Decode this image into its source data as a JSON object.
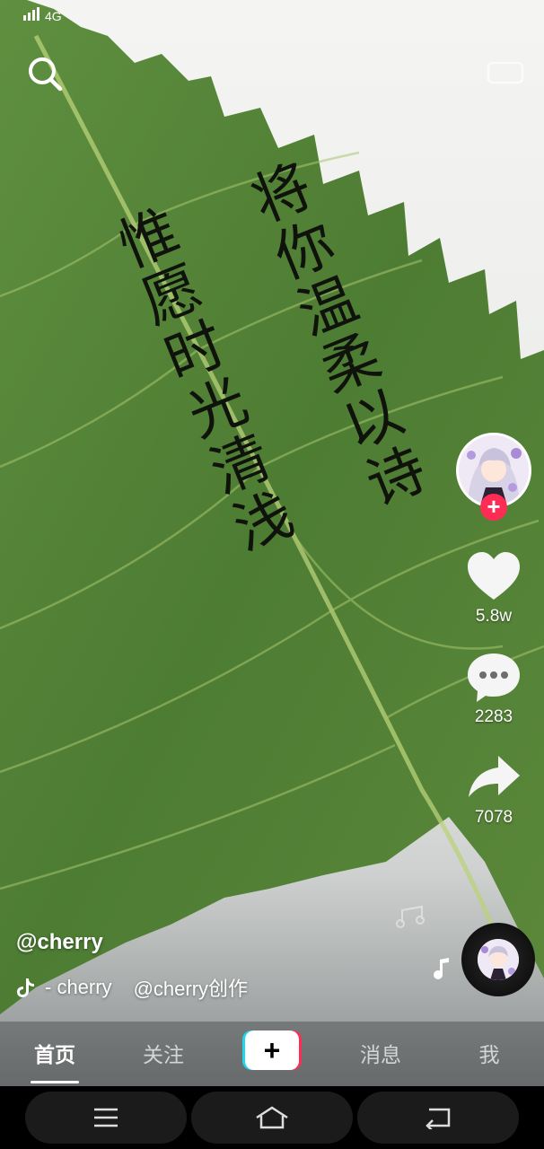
{
  "status_bar": {
    "network": "4G"
  },
  "poem": {
    "columns": [
      "将你温柔以诗",
      "惟愿时光清浅"
    ]
  },
  "creator": {
    "handle": "@cherry",
    "avatar_icon": "anime-girl-avatar-icon",
    "follow_symbol": "+"
  },
  "actions": {
    "likes": "5.8w",
    "comments": "2283",
    "shares": "7078"
  },
  "music": {
    "track": "- cherry",
    "credit": "@cherry创作"
  },
  "tabs": [
    {
      "label": "首页",
      "active": true
    },
    {
      "label": "关注",
      "active": false
    },
    {
      "label": "+",
      "active": false
    },
    {
      "label": "消息",
      "active": false
    },
    {
      "label": "我",
      "active": false
    }
  ],
  "colors": {
    "accent_red": "#fe2c55",
    "accent_cyan": "#20d5ec",
    "leaf_green": "#5a8a3c"
  }
}
